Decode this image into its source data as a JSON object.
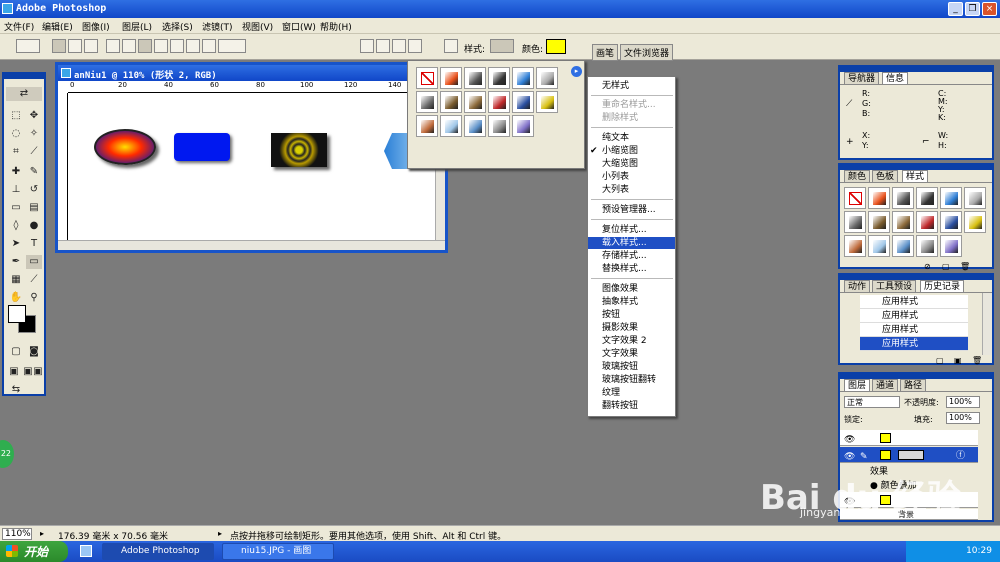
{
  "app": {
    "title": "Adobe Photoshop"
  },
  "menus": [
    "文件(F)",
    "编辑(E)",
    "图像(I)",
    "图层(L)",
    "选择(S)",
    "滤镜(T)",
    "视图(V)",
    "窗口(W)",
    "帮助(H)"
  ],
  "options": {
    "style_label": "样式:",
    "color_label": "颜色:",
    "color_value": "#ffff00",
    "brush_tab": "画笔",
    "browser_tab": "文件浏览器"
  },
  "document": {
    "title": "anNiu1 @ 110% (形状 2, RGB)",
    "ruler": [
      "0",
      "20",
      "40",
      "60",
      "80",
      "100",
      "120",
      "140"
    ]
  },
  "style_menu": {
    "items": [
      {
        "label": "无样式",
        "state": "normal"
      },
      {
        "label": "重命名样式...",
        "state": "disabled"
      },
      {
        "label": "删除样式",
        "state": "disabled"
      },
      {
        "label": "纯文本",
        "state": "normal"
      },
      {
        "label": "小缩览图",
        "state": "checked"
      },
      {
        "label": "大缩览图",
        "state": "normal"
      },
      {
        "label": "小列表",
        "state": "normal"
      },
      {
        "label": "大列表",
        "state": "normal"
      },
      {
        "label": "预设管理器...",
        "state": "normal"
      },
      {
        "label": "复位样式...",
        "state": "normal"
      },
      {
        "label": "载入样式...",
        "state": "highlight"
      },
      {
        "label": "存储样式...",
        "state": "normal"
      },
      {
        "label": "替换样式...",
        "state": "normal"
      },
      {
        "label": "图像效果",
        "state": "normal"
      },
      {
        "label": "抽象样式",
        "state": "normal"
      },
      {
        "label": "按钮",
        "state": "normal"
      },
      {
        "label": "摄影效果",
        "state": "normal"
      },
      {
        "label": "文字效果 2",
        "state": "normal"
      },
      {
        "label": "文字效果",
        "state": "normal"
      },
      {
        "label": "玻璃按钮",
        "state": "normal"
      },
      {
        "label": "玻璃按钮翻转",
        "state": "normal"
      },
      {
        "label": "纹理",
        "state": "normal"
      },
      {
        "label": "翻转按钮",
        "state": "normal"
      }
    ],
    "checkmark": "✔"
  },
  "swatches": [
    "none",
    "#e8501a",
    "#555555",
    "#333333",
    "#2f7fd6",
    "#aaaaaa",
    "#6a6a6a",
    "#7a5c2e",
    "#8c6a3a",
    "#c0282a",
    "#2a4fa0",
    "#d8c010",
    "#c06a3a",
    "#9fc6e8",
    "#5a8fc8",
    "#888888",
    "#8070c8"
  ],
  "nav_panel": {
    "tabs": [
      "导航器",
      "信息"
    ],
    "labels": [
      "R:",
      "G:",
      "B:",
      "C:",
      "M:",
      "Y:",
      "K:",
      "X:",
      "Y:",
      "W:",
      "H:"
    ]
  },
  "color_panel": {
    "tabs": [
      "颜色",
      "色板",
      "样式"
    ]
  },
  "history_panel": {
    "tabs": [
      "动作",
      "工具预设",
      "历史记录"
    ],
    "rows": [
      "应用样式",
      "应用样式",
      "应用样式",
      "应用样式"
    ]
  },
  "layers_panel": {
    "tabs": [
      "图层",
      "通道",
      "路径"
    ],
    "blend": "正常",
    "opacity_label": "不透明度:",
    "opacity": "100%",
    "lock_label": "锁定:",
    "fill_label": "填充:",
    "fill": "100%",
    "effects_label": "效果",
    "effect_item": "颜色叠加",
    "bg_label": "背景"
  },
  "status": {
    "zoom": "110%",
    "size": "176.39 毫米 x 70.56 毫米",
    "hint": "点按并拖移可绘制矩形。要用其他选项，使用 Shift、Alt 和 Ctrl 键。"
  },
  "taskbar": {
    "start": "开始",
    "tasks": [
      "Adobe Photoshop",
      "niu15.JPG - 画图"
    ],
    "time": "10:29"
  },
  "badge": "22",
  "watermark": {
    "main": "Bai du 经验",
    "sub": "jingyan.baidu.com"
  }
}
